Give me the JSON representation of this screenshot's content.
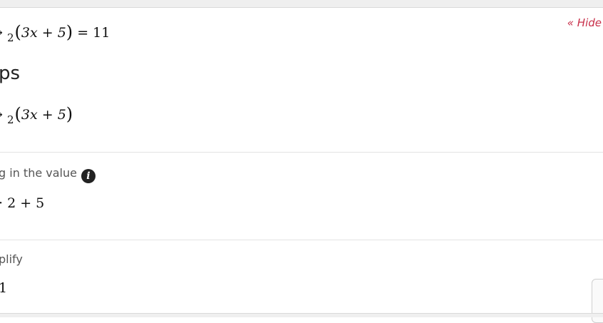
{
  "problem": {
    "arrow": "→",
    "limit_to": "2",
    "expression_inner": "3x + 5",
    "equals": "= 11"
  },
  "hide_link": "« Hide",
  "steps_title": "eps",
  "limit_expression": {
    "arrow": "→",
    "limit_to": "2",
    "expression_inner": "3x + 5"
  },
  "steps": [
    {
      "label": "g in the value",
      "math": "·  2 + 5",
      "has_info_icon": true
    },
    {
      "label": "plify",
      "math": "1"
    }
  ]
}
